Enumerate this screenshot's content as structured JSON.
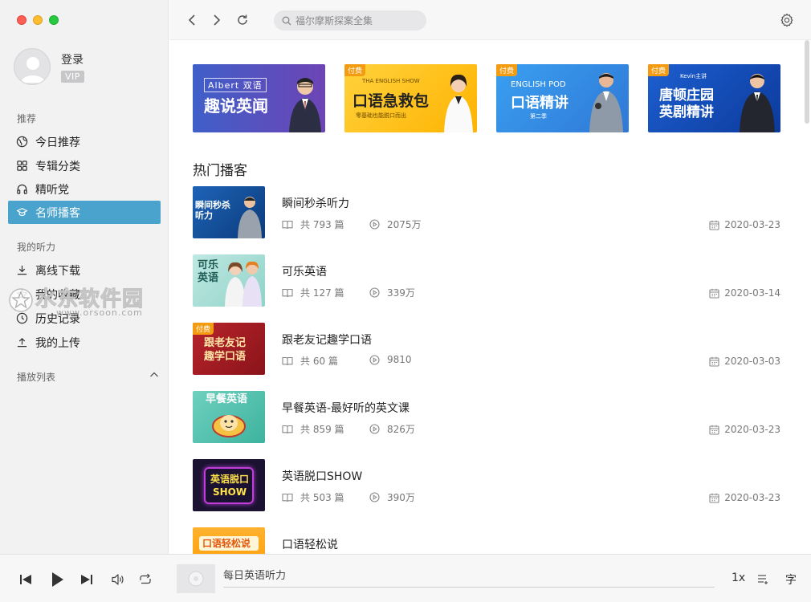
{
  "sidebar": {
    "user": {
      "login": "登录",
      "vip": "VIP"
    },
    "section_recommend": "推荐",
    "recommend_items": [
      {
        "label": "今日推荐",
        "icon": "globe-icon"
      },
      {
        "label": "专辑分类",
        "icon": "grid-icon"
      },
      {
        "label": "精听党",
        "icon": "headphones-icon"
      },
      {
        "label": "名师播客",
        "icon": "graduation-cap-icon",
        "active": true
      }
    ],
    "section_mine": "我的听力",
    "mine_items": [
      {
        "label": "离线下载",
        "icon": "download-icon"
      },
      {
        "label": "我的收藏",
        "icon": "star-icon"
      },
      {
        "label": "历史记录",
        "icon": "clock-icon"
      },
      {
        "label": "我的上传",
        "icon": "upload-icon"
      }
    ],
    "section_playlist": "播放列表",
    "watermark": {
      "big": "水东软件园",
      "small": "www.orsoon.com"
    }
  },
  "topbar": {
    "search_placeholder": "福尔摩斯探案全集"
  },
  "banners": [
    {
      "line1": "Albert 双语",
      "line2": "趣说英闻",
      "paid": ""
    },
    {
      "line1": "THA ENGLISH SHOW",
      "line2": "口语急救包",
      "line3": "零基础也能脱口而出",
      "paid": "付费"
    },
    {
      "line1": "ENGLISH POD",
      "line2": "口语精讲",
      "line3": "第二季",
      "paid": "付费"
    },
    {
      "line1": "Kevin主讲",
      "line2": "唐顿庄园",
      "line3": "英剧精讲",
      "paid": "付费"
    }
  ],
  "hot": {
    "title": "热门播客",
    "items": [
      {
        "title": "瞬间秒杀听力",
        "episodes": "共 793 篇",
        "plays": "2075万",
        "date": "2020-03-23",
        "thumb": "瞬间秒杀听力",
        "paid": ""
      },
      {
        "title": "可乐英语",
        "episodes": "共 127 篇",
        "plays": "339万",
        "date": "2020-03-14",
        "thumb": "可乐英语",
        "paid": ""
      },
      {
        "title": "跟老友记趣学口语",
        "episodes": "共 60 篇",
        "plays": "9810",
        "date": "2020-03-03",
        "thumb": "跟老友记趣学口语",
        "paid": "付费"
      },
      {
        "title": "早餐英语-最好听的英文课",
        "episodes": "共 859 篇",
        "plays": "826万",
        "date": "2020-03-23",
        "thumb": "早餐英语",
        "paid": ""
      },
      {
        "title": "英语脱口SHOW",
        "episodes": "共 503 篇",
        "plays": "390万",
        "date": "2020-03-23",
        "thumb": "英语脱口SHOW",
        "paid": ""
      },
      {
        "title": "口语轻松说",
        "episodes": "",
        "plays": "",
        "date": "",
        "thumb": "口语轻松说",
        "paid": ""
      }
    ]
  },
  "player": {
    "track": "每日英语听力",
    "speed": "1x",
    "subtitle": "字"
  },
  "colors": {
    "accent": "#4aa3cc",
    "paid_badge": "#f39c12"
  }
}
